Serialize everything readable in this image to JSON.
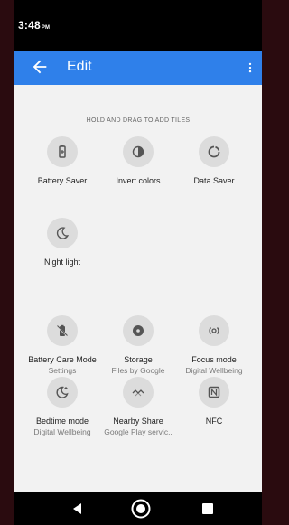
{
  "status_bar": {
    "time": "3:48",
    "ampm": "PM"
  },
  "app_bar": {
    "title": "Edit"
  },
  "hint": "HOLD AND DRAG TO ADD TILES",
  "available_tiles": [
    {
      "label": "Battery Saver",
      "icon": "battery-saver-icon"
    },
    {
      "label": "Invert colors",
      "icon": "invert-colors-icon"
    },
    {
      "label": "Data Saver",
      "icon": "data-saver-icon"
    },
    {
      "label": "Night light",
      "icon": "night-light-icon"
    }
  ],
  "app_tiles": [
    {
      "label": "Battery Care Mode",
      "sub": "Settings",
      "icon": "battery-care-icon"
    },
    {
      "label": "Storage",
      "sub": "Files by Google",
      "icon": "storage-icon"
    },
    {
      "label": "Focus mode",
      "sub": "Digital Wellbeing",
      "icon": "focus-mode-icon"
    },
    {
      "label": "Bedtime mode",
      "sub": "Digital Wellbeing",
      "icon": "bedtime-mode-icon"
    },
    {
      "label": "Nearby Share",
      "sub": "Google Play servic..",
      "icon": "nearby-share-icon"
    },
    {
      "label": "NFC",
      "sub": "",
      "icon": "nfc-icon"
    }
  ],
  "colors": {
    "app_bar": "#2f80ea",
    "content_bg": "#f2f2f2",
    "tile_circle": "#dcdcdc"
  }
}
